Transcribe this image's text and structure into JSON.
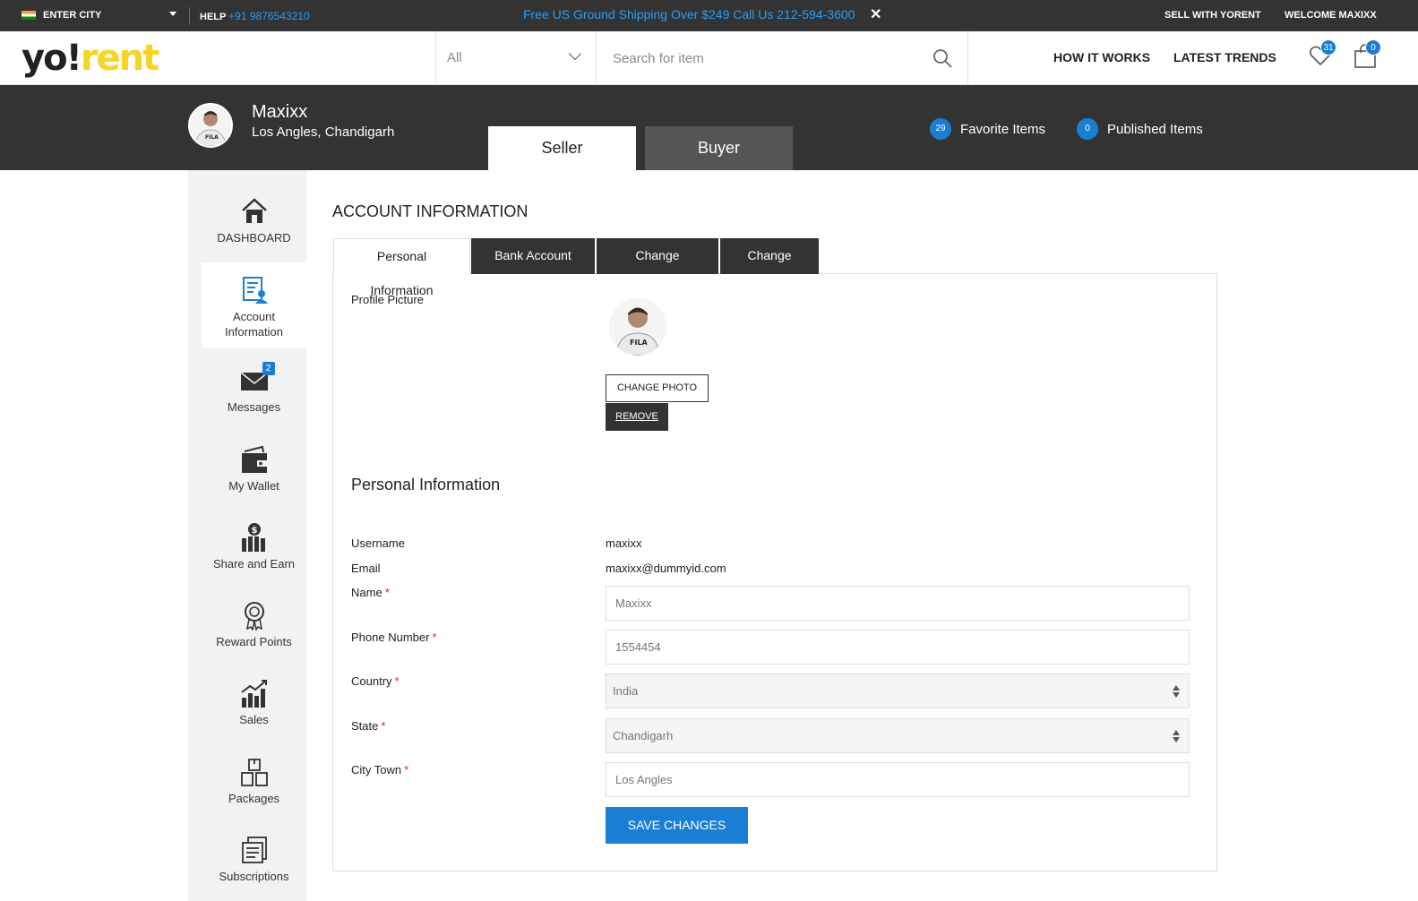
{
  "topbar": {
    "city_label": "ENTER CITY",
    "help_label": "HELP",
    "help_phone": "+91 9876543210",
    "promo_text": "Free US Ground Shipping Over $249 Call Us 212-594-3600",
    "promo_close": "✕",
    "sell_link": "SELL WITH YORENT",
    "welcome_text": "WELCOME MAXIXX"
  },
  "header": {
    "logo_yo": "yo",
    "logo_bang": "!",
    "logo_rent": "rent",
    "category_value": "All",
    "search_placeholder": "Search for item",
    "nav_how": "HOW IT WORKS",
    "nav_trends": "LATEST TRENDS",
    "favorites_count": "31",
    "cart_count": "0"
  },
  "profile_banner": {
    "name": "Maxixx",
    "location": "Los Angles, Chandigarh",
    "mode_seller": "Seller",
    "mode_buyer": "Buyer",
    "favorite_count": "29",
    "favorite_label": "Favorite Items",
    "published_count": "0",
    "published_label": "Published Items"
  },
  "sidebar": {
    "items": [
      {
        "label": "DASHBOARD",
        "icon": "home-icon"
      },
      {
        "label": "Account Information",
        "icon": "account-icon"
      },
      {
        "label": "Messages",
        "icon": "envelope-icon",
        "badge": "2"
      },
      {
        "label": "My Wallet",
        "icon": "wallet-icon"
      },
      {
        "label": "Share and Earn",
        "icon": "share-earn-icon"
      },
      {
        "label": "Reward Points",
        "icon": "award-icon"
      },
      {
        "label": "Sales",
        "icon": "sales-chart-icon"
      },
      {
        "label": "Packages",
        "icon": "packages-icon"
      },
      {
        "label": "Subscriptions",
        "icon": "subscriptions-icon"
      }
    ],
    "active_index": 1
  },
  "main": {
    "title": "ACCOUNT INFORMATION",
    "tabs": [
      {
        "label": "Personal Information"
      },
      {
        "label": "Bank Account Info"
      },
      {
        "label": "Change Password"
      },
      {
        "label": "Change Email"
      }
    ],
    "profile_picture_label": "Profile Picture",
    "change_photo": "CHANGE PHOTO",
    "remove": "REMOVE",
    "section_title": "Personal Information",
    "username_label": "Username",
    "username_value": "maxixx",
    "email_label": "Email",
    "email_value": "maxixx@dummyid.com",
    "name_label": "Name",
    "name_value": "Maxixx",
    "phone_label": "Phone Number",
    "phone_value": "1554454",
    "country_label": "Country",
    "country_value": "India",
    "state_label": "State",
    "state_value": "Chandigarh",
    "city_label": "City Town",
    "city_value": "Los Angles",
    "required_mark": "*",
    "save_button": "SAVE CHANGES"
  },
  "colors": {
    "accent_blue": "#1a7fd4",
    "dark_bar": "#333333",
    "logo_yellow": "#f5d623",
    "promo_blue": "#2a9df4"
  }
}
